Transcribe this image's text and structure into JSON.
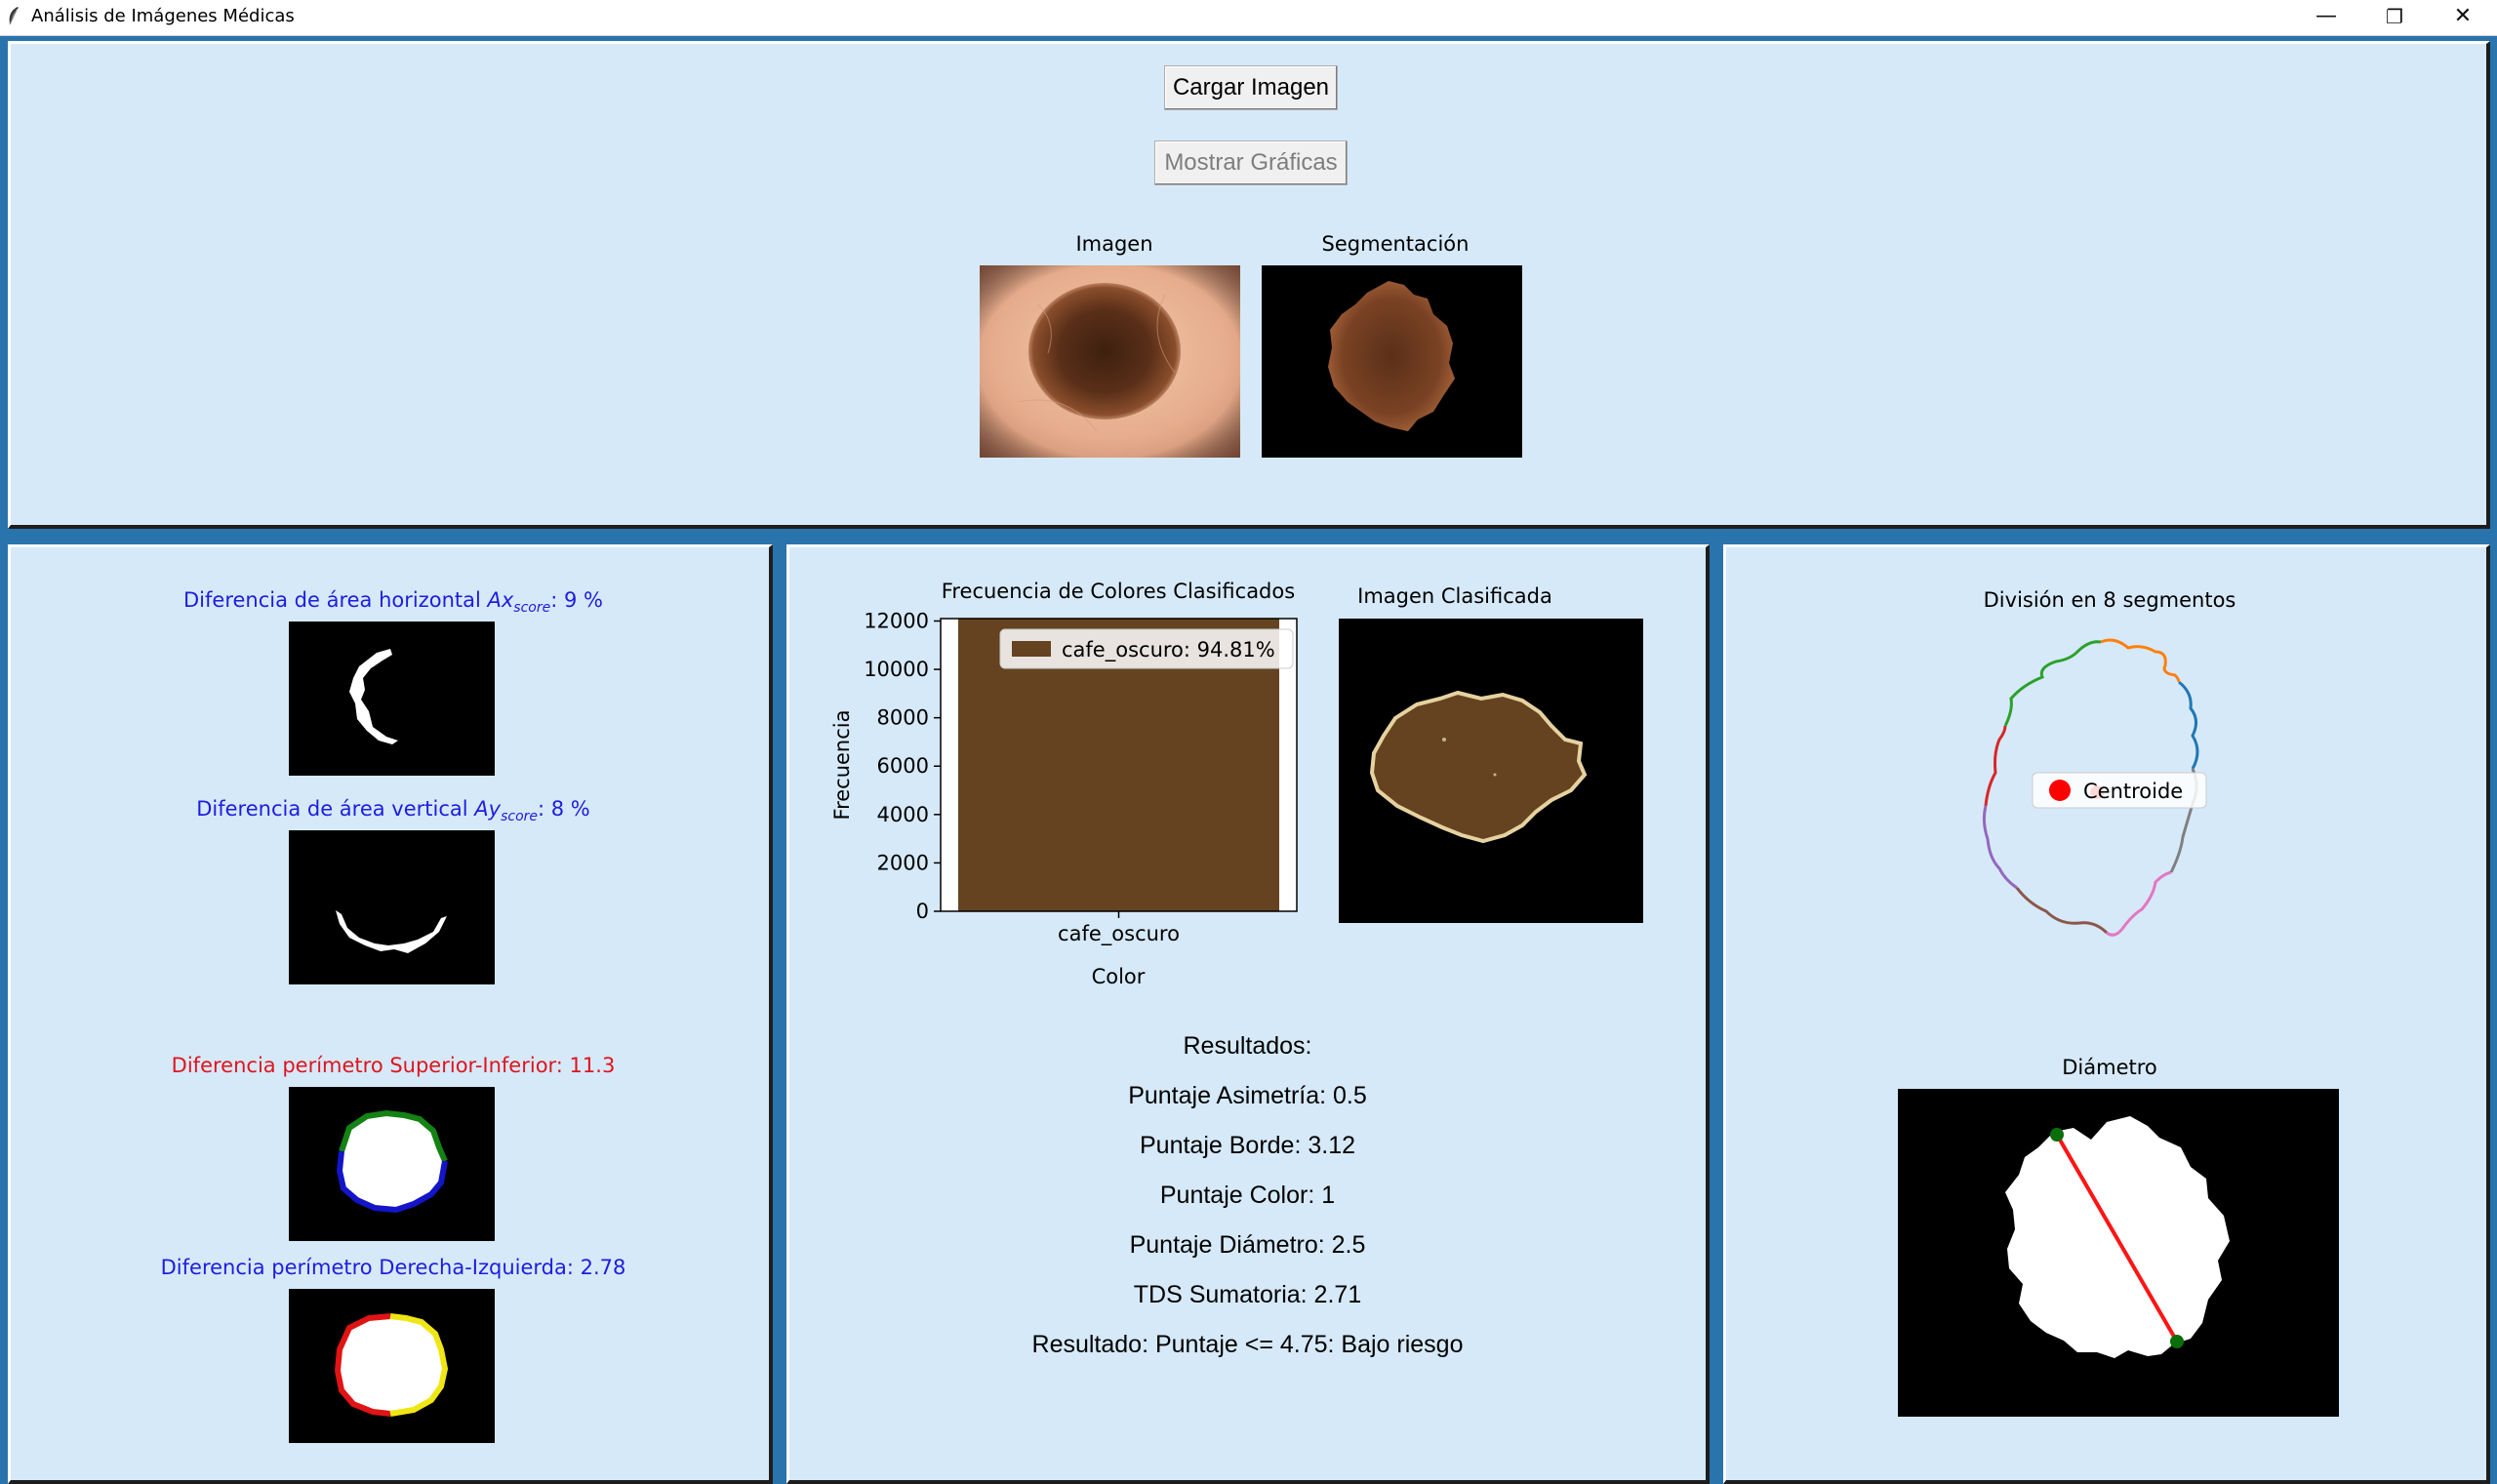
{
  "window": {
    "title": "Análisis de Imágenes Médicas",
    "minimize_glyph": "—",
    "restore_glyph": "❐",
    "close_glyph": "✕"
  },
  "top": {
    "load_button": "Cargar Imagen",
    "charts_button": "Mostrar Gráficas",
    "image_title": "Imagen",
    "segmentation_title": "Segmentación"
  },
  "asymmetry": {
    "horizontal": {
      "prefix": "Diferencia de área horizontal ",
      "var": "Ax",
      "sub": "score",
      "suffix": ": 9 %"
    },
    "vertical": {
      "prefix": "Diferencia de área vertical ",
      "var": "Ay",
      "sub": "score",
      "suffix": ": 8 %"
    },
    "perimeter_tb": "Diferencia perímetro Superior-Inferior: 11.3",
    "perimeter_rl": "Diferencia perímetro Derecha-Izquierda: 2.78"
  },
  "chart_data": {
    "type": "bar",
    "title": "Frecuencia de Colores Clasificados",
    "xlabel": "Color",
    "ylabel": "Frecuencia",
    "categories": [
      "cafe_oscuro"
    ],
    "values": [
      12100
    ],
    "ylim": [
      0,
      12100
    ],
    "yticks": [
      0,
      2000,
      4000,
      6000,
      8000,
      10000,
      12000
    ],
    "legend": "cafe_oscuro: 94.81%",
    "legend_position": "top-right",
    "bar_color": "#654321"
  },
  "classified": {
    "title": "Imagen Clasificada"
  },
  "results": {
    "heading": "Resultados:",
    "asymmetry": "Puntaje Asimetría: 0.5",
    "border": "Puntaje Borde: 3.12",
    "color": "Puntaje Color: 1",
    "diameter": "Puntaje Diámetro: 2.5",
    "tds": "TDS Sumatoria: 2.71",
    "result": "Resultado: Puntaje <= 4.75: Bajo riesgo"
  },
  "segments": {
    "title": "División en 8 segmentos",
    "legend": "Centroide",
    "colors": [
      "#1f77b4",
      "#ff7f0e",
      "#2ca02c",
      "#d62728",
      "#9467bd",
      "#8c564b",
      "#e377c2",
      "#7f7f7f"
    ]
  },
  "diameter": {
    "title": "Diámetro"
  }
}
